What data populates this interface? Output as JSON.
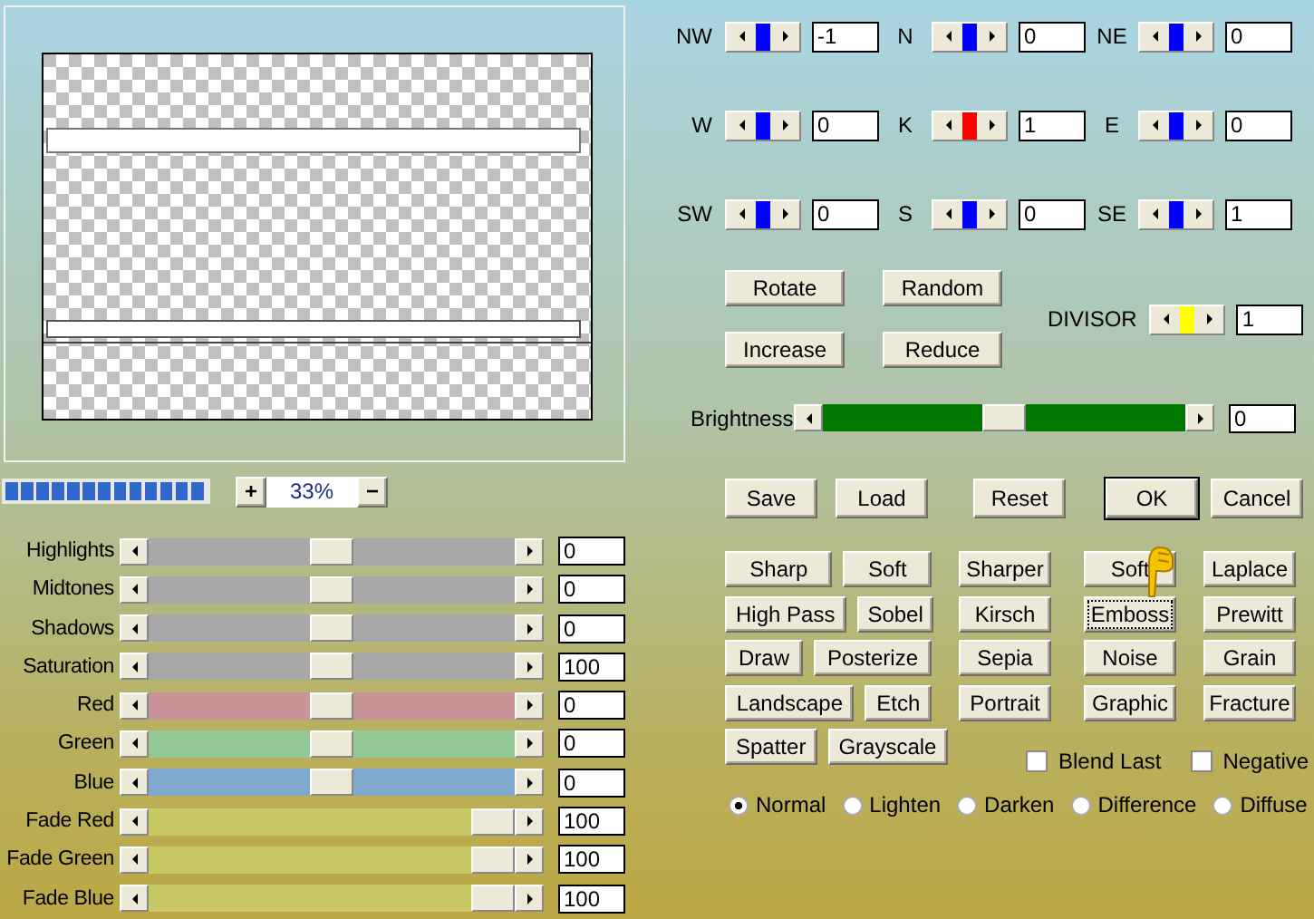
{
  "progress": {
    "level": 1
  },
  "zoom": {
    "plus": "+",
    "value": "33%",
    "minus": "−"
  },
  "adjustments": [
    {
      "label": "Highlights",
      "level": 0.5,
      "value": "0",
      "color": "#a8a8a8"
    },
    {
      "label": "Midtones",
      "level": 0.5,
      "value": "0",
      "color": "#a8a8a8"
    },
    {
      "label": "Shadows",
      "level": 0.5,
      "value": "0",
      "color": "#a8a8a8"
    },
    {
      "label": "Saturation",
      "level": 0.5,
      "value": "100",
      "color": "#a8a8a8"
    },
    {
      "label": "Red",
      "level": 0.5,
      "value": "0",
      "color": "#c89498"
    },
    {
      "label": "Green",
      "level": 0.5,
      "value": "0",
      "color": "#94c894"
    },
    {
      "label": "Blue",
      "level": 0.5,
      "value": "0",
      "color": "#80a8cc"
    },
    {
      "label": "Fade Red",
      "level": 1,
      "value": "100",
      "color": "#c8c864"
    },
    {
      "label": "Fade Green",
      "level": 1,
      "value": "100",
      "color": "#c8c864"
    },
    {
      "label": "Fade Blue",
      "level": 1,
      "value": "100",
      "color": "#c8c864"
    }
  ],
  "matrix": [
    [
      {
        "label": "NW",
        "value": "-1",
        "color": "#0000ff"
      },
      {
        "label": "N",
        "value": "0",
        "color": "#0000ff"
      },
      {
        "label": "NE",
        "value": "0",
        "color": "#0000ff"
      }
    ],
    [
      {
        "label": "W",
        "value": "0",
        "color": "#0000ff"
      },
      {
        "label": "K",
        "value": "1",
        "color": "#ff0000"
      },
      {
        "label": "E",
        "value": "0",
        "color": "#0000ff"
      }
    ],
    [
      {
        "label": "SW",
        "value": "0",
        "color": "#0000ff"
      },
      {
        "label": "S",
        "value": "0",
        "color": "#0000ff"
      },
      {
        "label": "SE",
        "value": "1",
        "color": "#0000ff"
      }
    ]
  ],
  "actions": [
    "Rotate",
    "Random",
    "Increase",
    "Reduce"
  ],
  "divisor": {
    "label": "DIVISOR",
    "value": "1",
    "color": "#ffff00"
  },
  "brightness": {
    "label": "Brightness",
    "level": 0.5,
    "value": "0"
  },
  "dialog_buttons": [
    {
      "label": "Save",
      "default": false
    },
    {
      "label": "Load",
      "default": false
    },
    {
      "label": "Reset",
      "default": false
    },
    {
      "label": "OK",
      "default": true
    },
    {
      "label": "Cancel",
      "default": false
    }
  ],
  "presets": [
    [
      {
        "label": "Sharp",
        "focused": false
      },
      {
        "label": "Soft",
        "focused": false
      },
      {
        "label": "Sharper",
        "focused": false
      },
      {
        "label": "Soft",
        "focused": false
      },
      {
        "label": "Laplace",
        "focused": false
      }
    ],
    [
      {
        "label": "High Pass",
        "focused": false
      },
      {
        "label": "Sobel",
        "focused": false
      },
      {
        "label": "Kirsch",
        "focused": false
      },
      {
        "label": "Emboss",
        "focused": true
      },
      {
        "label": "Prewitt",
        "focused": false
      }
    ],
    [
      {
        "label": "Draw",
        "focused": false
      },
      {
        "label": "Posterize",
        "focused": false
      },
      {
        "label": "Sepia",
        "focused": false
      },
      {
        "label": "Noise",
        "focused": false
      },
      {
        "label": "Grain",
        "focused": false
      }
    ],
    [
      {
        "label": "Landscape",
        "focused": false
      },
      {
        "label": "Etch",
        "focused": false
      },
      {
        "label": "Portrait",
        "focused": false
      },
      {
        "label": "Graphic",
        "focused": false
      },
      {
        "label": "Fracture",
        "focused": false
      }
    ],
    [
      {
        "label": "Spatter",
        "focused": false
      },
      {
        "label": "Grayscale",
        "focused": false
      }
    ]
  ],
  "options": [
    {
      "label": "Blend Last",
      "checked": false
    },
    {
      "label": "Negative",
      "checked": false
    }
  ],
  "modes": [
    {
      "label": "Normal",
      "selected": true
    },
    {
      "label": "Lighten",
      "selected": false
    },
    {
      "label": "Darken",
      "selected": false
    },
    {
      "label": "Difference",
      "selected": false
    },
    {
      "label": "Diffuse",
      "selected": false
    }
  ]
}
